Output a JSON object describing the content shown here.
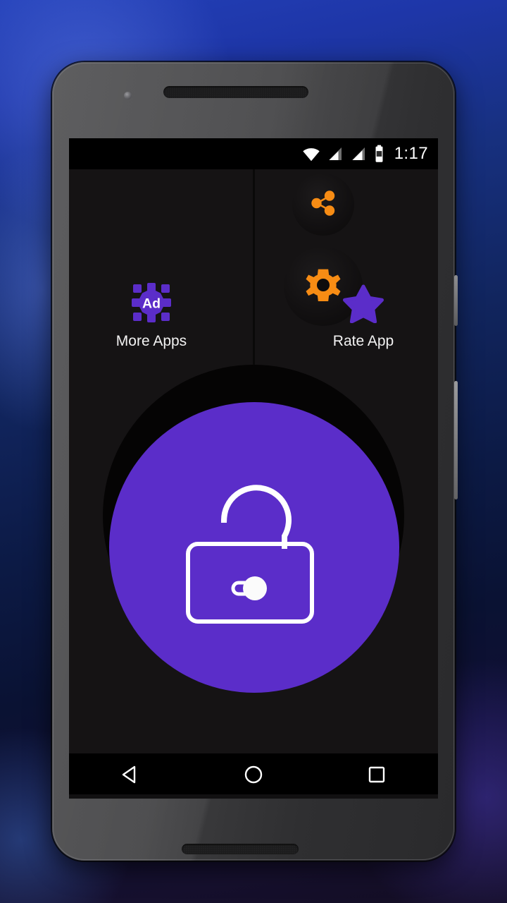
{
  "device": {
    "name": "android-phone",
    "frame_color": "#3a3a3c",
    "hardware": {
      "earpiece": "earpiece-speaker",
      "front_camera": "front-camera",
      "bottom_speaker": "bottom-speaker",
      "power_button": "power-button",
      "volume_button": "volume-button"
    }
  },
  "wallpaper": {
    "name": "blue-gradient-wallpaper",
    "colors": [
      "#2340b8",
      "#11255e",
      "#0a1233",
      "#130d22"
    ]
  },
  "status_bar": {
    "background": "#000000",
    "clock": "1:17",
    "icons": [
      {
        "name": "wifi-icon",
        "label": "Wi-Fi"
      },
      {
        "name": "signal-bars-icon-1",
        "label": "Mobile signal 1"
      },
      {
        "name": "signal-bars-icon-2",
        "label": "Mobile signal 2"
      },
      {
        "name": "battery-icon",
        "label": "Battery"
      }
    ]
  },
  "app": {
    "background": "#151314",
    "accent_orange": "#f78c14",
    "accent_purple": "#5b2dc9",
    "top_actions": [
      {
        "name": "share-button",
        "icon": "share-icon",
        "label": "Share"
      },
      {
        "name": "settings-button",
        "icon": "gear-icon",
        "label": "Settings"
      }
    ],
    "side_actions": [
      {
        "name": "more-apps-button",
        "icon": "ad-icon",
        "label": "More Apps"
      },
      {
        "name": "rate-app-button",
        "icon": "star-icon",
        "label": "Rate App"
      }
    ],
    "main_button": {
      "name": "unlock-button",
      "icon": "open-padlock-icon",
      "label": "Unlock",
      "fill": "#5b2dc9",
      "stroke": "#ffffff"
    }
  },
  "nav_bar": {
    "background": "#000000",
    "buttons": [
      {
        "name": "nav-back-button",
        "icon": "triangle-back-icon",
        "label": "Back"
      },
      {
        "name": "nav-home-button",
        "icon": "circle-home-icon",
        "label": "Home"
      },
      {
        "name": "nav-recents-button",
        "icon": "square-recents-icon",
        "label": "Recents"
      }
    ]
  }
}
